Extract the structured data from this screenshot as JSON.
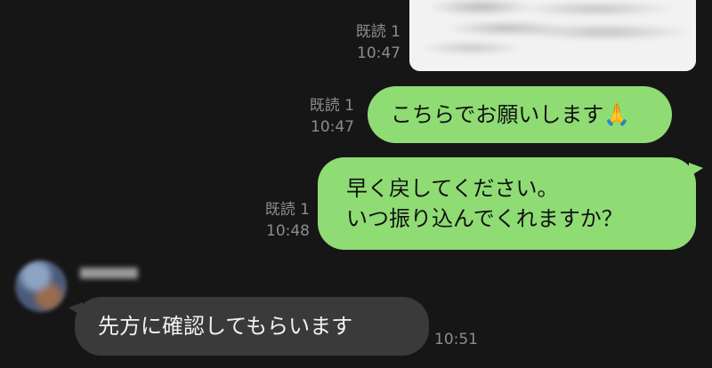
{
  "messages": [
    {
      "direction": "outgoing",
      "type": "image",
      "read_label": "既読 1",
      "time": "10:47"
    },
    {
      "direction": "outgoing",
      "type": "text",
      "lines": [
        "こちらでお願いします🙏"
      ],
      "read_label": "既読 1",
      "time": "10:47"
    },
    {
      "direction": "outgoing",
      "type": "text",
      "lines": [
        "早く戻してください。",
        "いつ振り込んでくれますか？"
      ],
      "read_label": "既読 1",
      "time": "10:48"
    },
    {
      "direction": "incoming",
      "type": "text",
      "lines": [
        "先方に確認してもらいます"
      ],
      "time": "10:51"
    }
  ],
  "colors": {
    "background": "#161616",
    "outgoing_bubble": "#8fdc74",
    "incoming_bubble": "#3a3a3a",
    "meta_text": "#8c8c8c"
  },
  "icons": {
    "avatar": "sender-avatar",
    "emoji": "folded-hands"
  }
}
